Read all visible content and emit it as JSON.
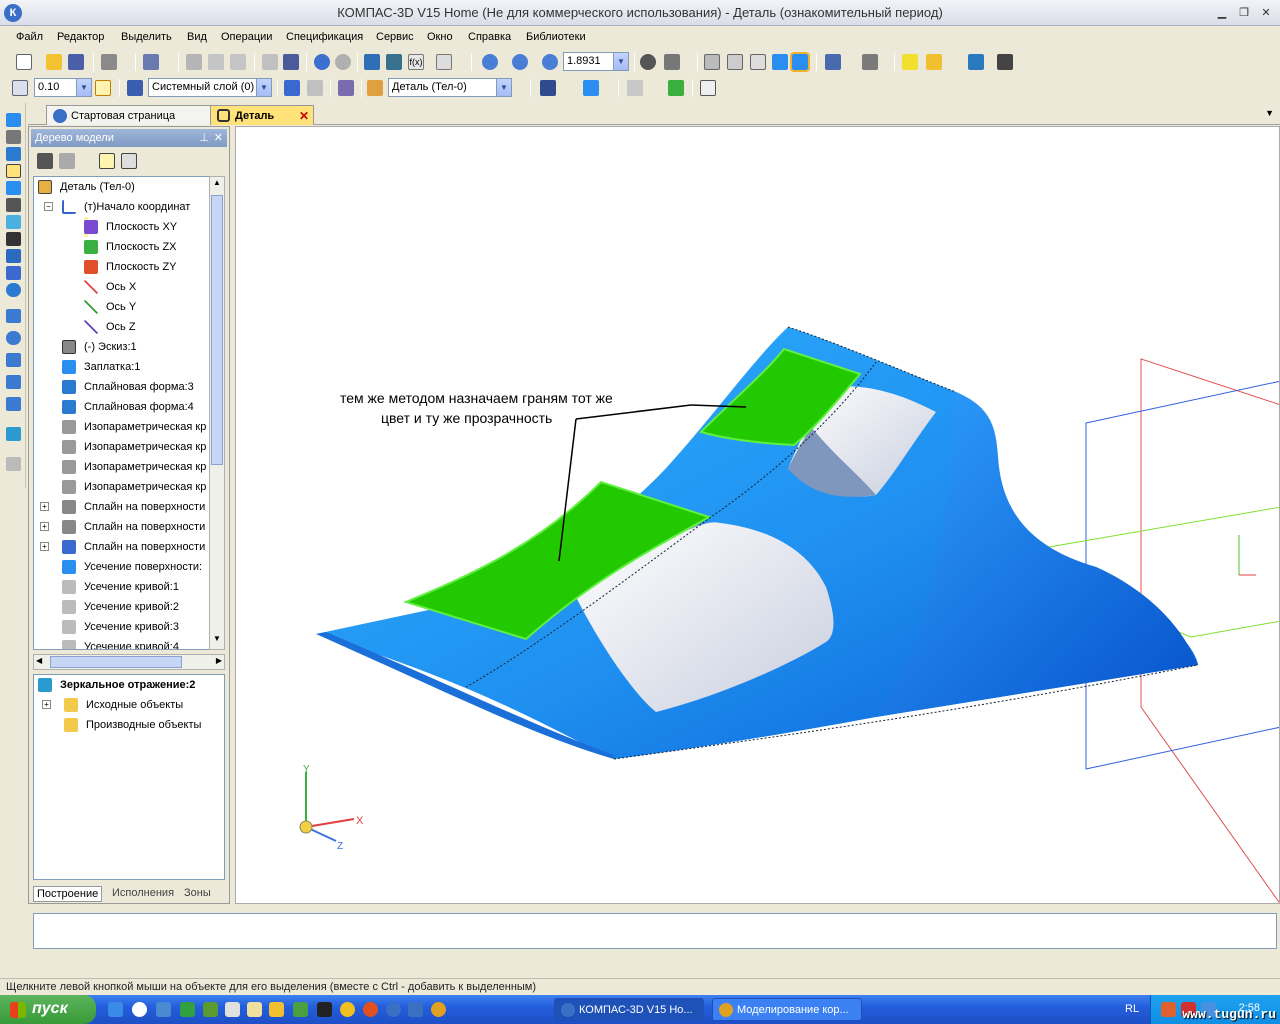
{
  "window": {
    "title": "КОМПАС-3D V15 Home (Не для коммерческого использования) - Деталь (ознакомительный период)",
    "logo": "К"
  },
  "menu": [
    "Файл",
    "Редактор",
    "Выделить",
    "Вид",
    "Операции",
    "Спецификация",
    "Сервис",
    "Окно",
    "Справка",
    "Библиотеки"
  ],
  "toolbar": {
    "zoom_value": "1.8931",
    "step_value": "0.10",
    "layer": "Системный слой (0)",
    "part_selector": "Деталь (Тел-0)"
  },
  "doc_tabs": {
    "start_page": "Стартовая страница",
    "detail": "Деталь"
  },
  "tree": {
    "title": "Дерево модели",
    "nodes": [
      "Деталь (Тел-0)",
      "(т)Начало координат",
      "Плоскость XY",
      "Плоскость ZX",
      "Плоскость ZY",
      "Ось X",
      "Ось Y",
      "Ось Z",
      "(-) Эскиз:1",
      "Заплатка:1",
      "Сплайновая форма:3",
      "Сплайновая форма:4",
      "Изопараметрическая кр",
      "Изопараметрическая кр",
      "Изопараметрическая кр",
      "Изопараметрическая кр",
      "Сплайн на поверхности",
      "Сплайн на поверхности",
      "Сплайн на поверхности",
      "Усечение поверхности:",
      "Усечение кривой:1",
      "Усечение кривой:2",
      "Усечение кривой:3",
      "Усечение кривой:4"
    ],
    "mirror": {
      "title": "Зеркальное отражение:2",
      "children": [
        "Исходные объекты",
        "Производные объекты"
      ]
    },
    "tabs": [
      "Построение",
      "Исполнения",
      "Зоны"
    ]
  },
  "viewport": {
    "annotation_line1": "тем же методом назначаем граням тот же",
    "annotation_line2": "цвет и ту же прозрачность",
    "axes": {
      "x": "X",
      "y": "Y",
      "z": "Z"
    }
  },
  "status_text": "Щелкните левой кнопкой мыши на объекте для его выделения (вместе с Ctrl - добавить к выделенным)",
  "taskbar": {
    "start": "пуск",
    "tasks": [
      "КОМПАС-3D V15 Ho...",
      "Моделирование кор..."
    ],
    "lang": "RL",
    "clock": "2:58"
  },
  "watermark": "www.tugun.ru",
  "colors": {
    "surface_blue": "#1e8cf0",
    "face_green": "#22c800",
    "tab_active": "#ffe27a"
  }
}
